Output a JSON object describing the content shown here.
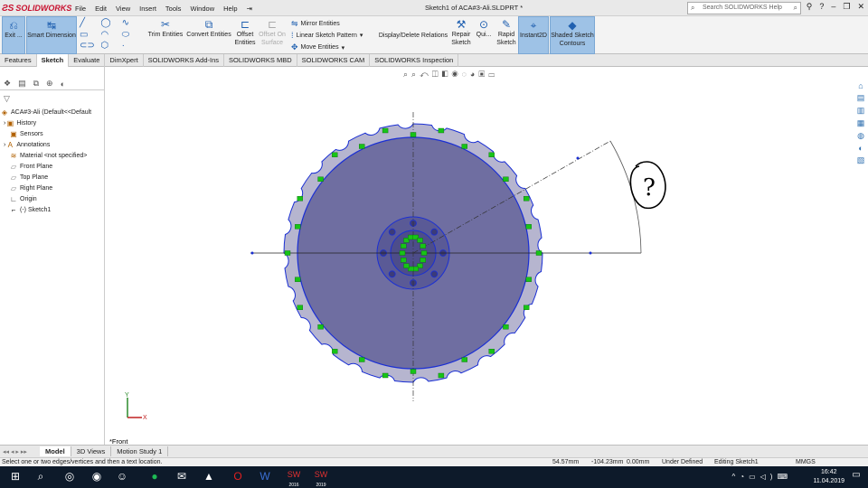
{
  "app": {
    "brand": "SOLIDWORKS",
    "doc_title": "Sketch1 of ACA#3-Ali.SLDPRT *"
  },
  "menu": [
    "File",
    "Edit",
    "View",
    "Insert",
    "Tools",
    "Window",
    "Help"
  ],
  "help_search": {
    "placeholder": "Search SOLIDWORKS Help"
  },
  "toolbar": {
    "exit": "Exit ...",
    "smart_dimension": "Smart Dimension",
    "trim": "Trim Entities",
    "convert": "Convert Entities",
    "offset": "Offset Entities",
    "offset_surface": "Offset On Surface",
    "mirror": "Mirror Entities",
    "linear_pattern": "Linear Sketch Pattern",
    "move": "Move Entities",
    "display_delete": "Display/Delete Relations",
    "repair": "Repair Sketch",
    "quick": "Qui...",
    "rapid": "Rapid Sketch",
    "instant2d": "Instant2D",
    "shaded": "Shaded Sketch Contours"
  },
  "tabs": [
    "Features",
    "Sketch",
    "Evaluate",
    "DimXpert",
    "SOLIDWORKS Add-Ins",
    "SOLIDWORKS MBD",
    "SOLIDWORKS CAM",
    "SOLIDWORKS Inspection"
  ],
  "active_tab": "Sketch",
  "tree": {
    "root": "ACA#3-Ali  (Default<<Default",
    "items": [
      "History",
      "Sensors",
      "Annotations",
      "Material <not specified>",
      "Front Plane",
      "Top Plane",
      "Right Plane",
      "Origin",
      "(-) Sketch1"
    ]
  },
  "viewport": {
    "view_label": "*Front",
    "annotation": "?",
    "axis_x": "X",
    "axis_y": "Y"
  },
  "bottom_tabs": [
    "Model",
    "3D Views",
    "Motion Study 1"
  ],
  "status": {
    "message": "Select one or two edges/vertices and then a text location.",
    "x": "54.57mm",
    "y": "-104.23mm",
    "z": "0.00mm",
    "state": "Under Defined",
    "editing": "Editing Sketch1",
    "units": "MMGS"
  },
  "clock": {
    "time": "16:42",
    "date": "11.04.2019"
  },
  "taskbar_labels": {
    "sw1": "2016",
    "sw2": "2019"
  },
  "colors": {
    "sketch_blue": "#1a2fd4",
    "fill": "#6f6ea1",
    "relation_green": "#17c417"
  }
}
